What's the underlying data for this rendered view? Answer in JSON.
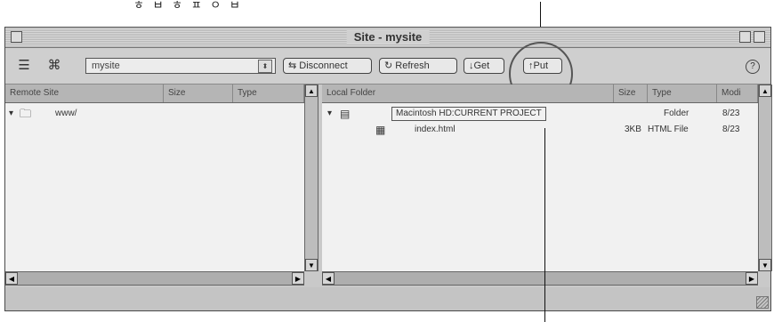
{
  "caption": {
    "text": "ㅎ ㅂ ㅎ ㅍ ㅇ ㅂ"
  },
  "window": {
    "title": "Site - mysite"
  },
  "toolbar": {
    "site_name": "mysite",
    "connect_label": "Disconnect",
    "refresh_label": "Refresh",
    "get_label": "Get",
    "put_label": "Put",
    "help_glyph": "?"
  },
  "remote_pane": {
    "columns": [
      "Remote Site",
      "Size",
      "Type"
    ],
    "rows": [
      {
        "name": "www/"
      }
    ]
  },
  "local_pane": {
    "columns": [
      "Local Folder",
      "Size",
      "Type",
      "Modi"
    ],
    "rows": [
      {
        "name": "Macintosh HD:CURRENT PROJECT",
        "size": "",
        "type": "Folder",
        "modified": "8/23"
      },
      {
        "name": "index.html",
        "size": "3KB",
        "type": "HTML File",
        "modified": "8/23"
      }
    ]
  },
  "icons": {
    "site_files_icon": "site-files-icon",
    "site_map_icon": "site-map-icon",
    "folder_icon": "folder-icon",
    "file_icon": "html-file-icon"
  }
}
